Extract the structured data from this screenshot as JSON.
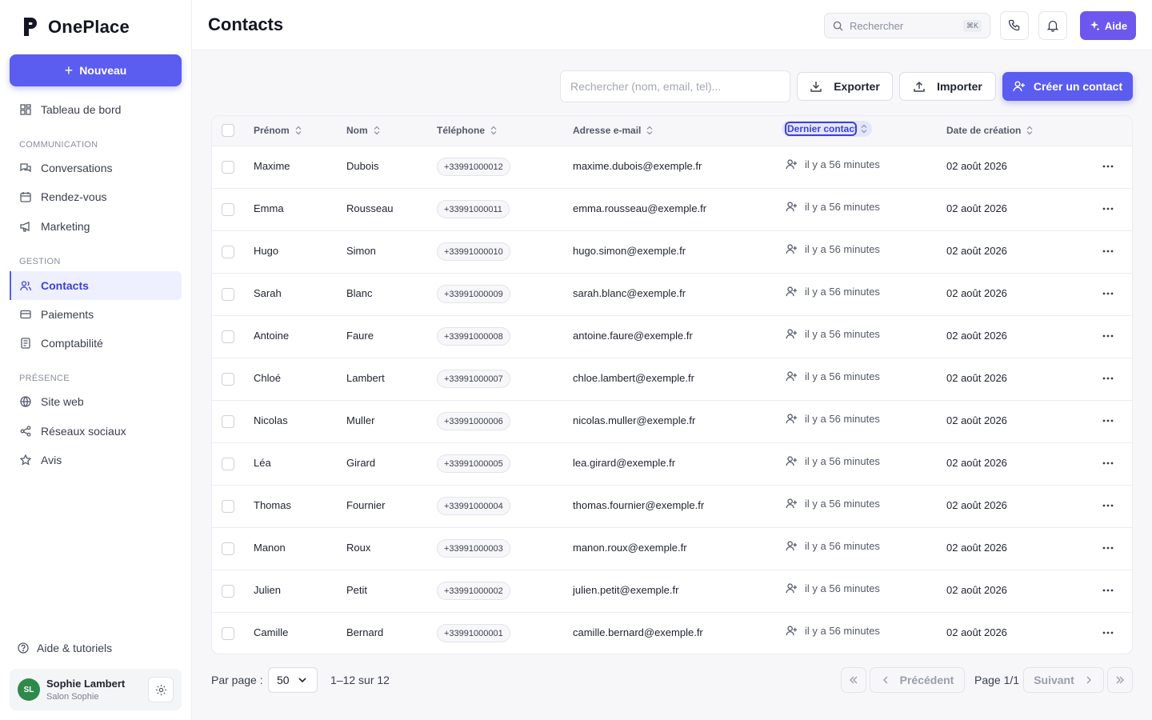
{
  "app": {
    "name": "OnePlace"
  },
  "sidebar": {
    "new_label": "Nouveau",
    "dashboard_label": "Tableau de bord",
    "sections": [
      {
        "label": "COMMUNICATION",
        "items": [
          {
            "label": "Conversations",
            "icon": "chat-icon"
          },
          {
            "label": "Rendez-vous",
            "icon": "calendar-icon"
          },
          {
            "label": "Marketing",
            "icon": "megaphone-icon"
          }
        ]
      },
      {
        "label": "GESTION",
        "items": [
          {
            "label": "Contacts",
            "icon": "users-icon",
            "active": true
          },
          {
            "label": "Paiements",
            "icon": "credit-card-icon"
          },
          {
            "label": "Comptabilité",
            "icon": "ledger-icon"
          }
        ]
      },
      {
        "label": "PRÉSENCE",
        "items": [
          {
            "label": "Site web",
            "icon": "globe-icon"
          },
          {
            "label": "Réseaux sociaux",
            "icon": "share-icon"
          },
          {
            "label": "Avis",
            "icon": "star-icon"
          }
        ]
      }
    ],
    "help_label": "Aide & tutoriels",
    "user": {
      "initials": "SL",
      "name": "Sophie Lambert",
      "subtitle": "Salon Sophie",
      "avatar_color": "#2e8a4a"
    }
  },
  "topbar": {
    "title": "Contacts",
    "search_placeholder": "Rechercher",
    "search_shortcut": "⌘K",
    "aide_label": "Aide"
  },
  "toolbar": {
    "search_placeholder": "Rechercher (nom, email, tel)...",
    "export_label": "Exporter",
    "import_label": "Importer",
    "create_label": "Créer un contact"
  },
  "table": {
    "headers": {
      "first_name": "Prénom",
      "last_name": "Nom",
      "phone": "Téléphone",
      "email": "Adresse e-mail",
      "last_contact": "Dernier contact",
      "created": "Date de création"
    },
    "rows": [
      {
        "first_name": "Maxime",
        "last_name": "Dubois",
        "phone": "+33991000012",
        "email": "maxime.dubois@exemple.fr",
        "last_contact": "il y a 56 minutes",
        "created": "02 août 2026"
      },
      {
        "first_name": "Emma",
        "last_name": "Rousseau",
        "phone": "+33991000011",
        "email": "emma.rousseau@exemple.fr",
        "last_contact": "il y a 56 minutes",
        "created": "02 août 2026"
      },
      {
        "first_name": "Hugo",
        "last_name": "Simon",
        "phone": "+33991000010",
        "email": "hugo.simon@exemple.fr",
        "last_contact": "il y a 56 minutes",
        "created": "02 août 2026"
      },
      {
        "first_name": "Sarah",
        "last_name": "Blanc",
        "phone": "+33991000009",
        "email": "sarah.blanc@exemple.fr",
        "last_contact": "il y a 56 minutes",
        "created": "02 août 2026"
      },
      {
        "first_name": "Antoine",
        "last_name": "Faure",
        "phone": "+33991000008",
        "email": "antoine.faure@exemple.fr",
        "last_contact": "il y a 56 minutes",
        "created": "02 août 2026"
      },
      {
        "first_name": "Chloé",
        "last_name": "Lambert",
        "phone": "+33991000007",
        "email": "chloe.lambert@exemple.fr",
        "last_contact": "il y a 56 minutes",
        "created": "02 août 2026"
      },
      {
        "first_name": "Nicolas",
        "last_name": "Muller",
        "phone": "+33991000006",
        "email": "nicolas.muller@exemple.fr",
        "last_contact": "il y a 56 minutes",
        "created": "02 août 2026"
      },
      {
        "first_name": "Léa",
        "last_name": "Girard",
        "phone": "+33991000005",
        "email": "lea.girard@exemple.fr",
        "last_contact": "il y a 56 minutes",
        "created": "02 août 2026"
      },
      {
        "first_name": "Thomas",
        "last_name": "Fournier",
        "phone": "+33991000004",
        "email": "thomas.fournier@exemple.fr",
        "last_contact": "il y a 56 minutes",
        "created": "02 août 2026"
      },
      {
        "first_name": "Manon",
        "last_name": "Roux",
        "phone": "+33991000003",
        "email": "manon.roux@exemple.fr",
        "last_contact": "il y a 56 minutes",
        "created": "02 août 2026"
      },
      {
        "first_name": "Julien",
        "last_name": "Petit",
        "phone": "+33991000002",
        "email": "julien.petit@exemple.fr",
        "last_contact": "il y a 56 minutes",
        "created": "02 août 2026"
      },
      {
        "first_name": "Camille",
        "last_name": "Bernard",
        "phone": "+33991000001",
        "email": "camille.bernard@exemple.fr",
        "last_contact": "il y a 56 minutes",
        "created": "02 août 2026"
      }
    ]
  },
  "pagination": {
    "per_page_label": "Par page :",
    "per_page_value": "50",
    "range_text": "1–12 sur 12",
    "prev_label": "Précédent",
    "next_label": "Suivant",
    "page_text": "Page 1/1"
  },
  "colors": {
    "accent": "#5b5cf0",
    "aide": "#6e57ee",
    "active_bg": "#eef0ff"
  }
}
